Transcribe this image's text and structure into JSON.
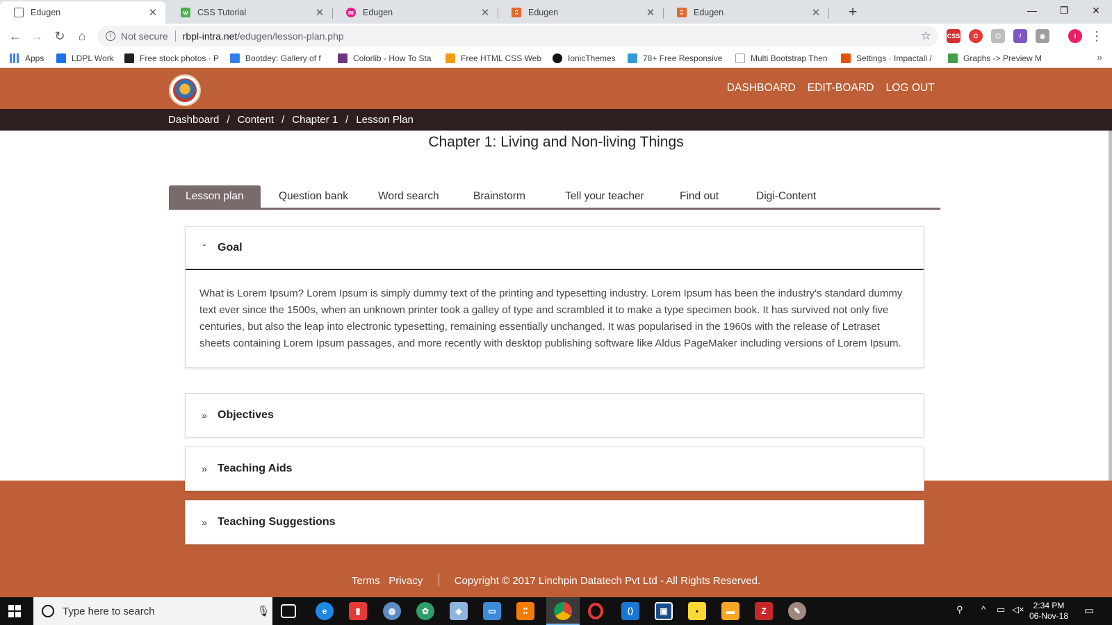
{
  "browser": {
    "tabs": [
      {
        "title": "Edugen",
        "icon": "page-icon",
        "color": "#5f6368"
      },
      {
        "title": "CSS Tutorial",
        "icon": "w3schools-icon",
        "color": "#4caf50"
      },
      {
        "title": "Edugen",
        "icon": "edugen-pink-icon",
        "color": "#e91e8c"
      },
      {
        "title": "Edugen",
        "icon": "edugen-orange-icon",
        "color": "#e8652b"
      },
      {
        "title": "Edugen",
        "icon": "edugen-orange-icon",
        "color": "#e8652b"
      }
    ],
    "new_tab": "+",
    "window_controls": {
      "minimize": "—",
      "maximize": "❐",
      "close": "✕"
    },
    "address": {
      "security": "Not secure",
      "host": "rbpl-intra.net",
      "path": "/edugen/lesson-plan.php"
    },
    "bookmarks": [
      {
        "label": "Apps",
        "color": "#4285f4"
      },
      {
        "label": "LDPL Work",
        "color": "#1a73e8"
      },
      {
        "label": "Free stock photos · P",
        "color": "#222222"
      },
      {
        "label": "Bootdey: Gallery of f",
        "color": "#2f80ed"
      },
      {
        "label": "Colorlib - How To Sta",
        "color": "#6c3483"
      },
      {
        "label": "Free HTML CSS Webs",
        "color": "#f39c12"
      },
      {
        "label": "IonicThemes",
        "color": "#111111"
      },
      {
        "label": "78+ Free Responsive",
        "color": "#3498db"
      },
      {
        "label": "Multi Bootstrap Then",
        "color": "#9e9e9e"
      },
      {
        "label": "Settings · Impactall /",
        "color": "#e65100"
      },
      {
        "label": "Graphs -> Preview M",
        "color": "#43a047"
      }
    ],
    "bookmarks_more": "»"
  },
  "header": {
    "nav": [
      "DASHBOARD",
      "EDIT-BOARD",
      "LOG OUT"
    ]
  },
  "breadcrumb": [
    "Dashboard",
    "Content",
    "Chapter 1",
    "Lesson Plan"
  ],
  "breadcrumb_sep": "/",
  "chapter_title": "Chapter 1: Living and Non-living Things",
  "content_tabs": [
    "Lesson plan",
    "Question bank",
    "Word search",
    "Brainstorm",
    "Tell your teacher",
    "Find out",
    "Digi-Content"
  ],
  "active_tab": "Lesson plan",
  "panels": [
    {
      "title": "Goal",
      "open": true,
      "body": "What is Lorem Ipsum? Lorem Ipsum is simply dummy text of the printing and typesetting industry. Lorem Ipsum has been the industry's standard dummy text ever since the 1500s, when an unknown printer took a galley of type and scrambled it to make a type specimen book. It has survived not only five centuries, but also the leap into electronic typesetting, remaining essentially unchanged. It was popularised in the 1960s with the release of Letraset sheets containing Lorem Ipsum passages, and more recently with desktop publishing software like Aldus PageMaker including versions of Lorem Ipsum."
    },
    {
      "title": "Objectives",
      "open": false
    },
    {
      "title": "Teaching Aids",
      "open": false
    },
    {
      "title": "Teaching Suggestions",
      "open": false
    }
  ],
  "footer": {
    "links": [
      "Terms",
      "Privacy"
    ],
    "copyright": "Copyright © 2017 Linchpin Datatech Pvt Ltd - All Rights Reserved."
  },
  "taskbar": {
    "search_placeholder": "Type here to search",
    "time": "2:34 PM",
    "date": "06-Nov-18"
  },
  "colors": {
    "brand": "#bf5f38",
    "breadcrumb_bg": "#2e1e1e",
    "tab_active": "#7a6b6b"
  }
}
